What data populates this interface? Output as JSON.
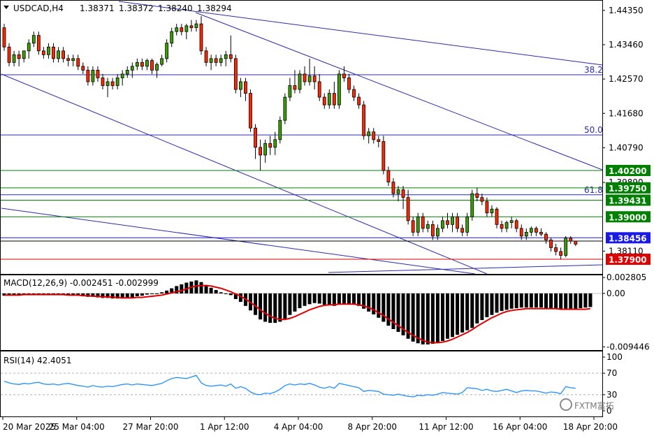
{
  "chart_data": {
    "type": "candlestick",
    "symbol_header": {
      "symbol": "USDCAD,H4",
      "open": "1.38371",
      "high": "1.38372",
      "low": "1.38240",
      "close": "1.38294"
    },
    "price_axis": {
      "ylim": [
        1.3752,
        1.446
      ],
      "ticks": [
        "1.44350",
        "1.43460",
        "1.42570",
        "1.41680",
        "1.40790",
        "1.39890",
        "1.38110"
      ]
    },
    "time_axis": {
      "labels": [
        "20 Mar 2025",
        "25 Mar 04:00",
        "27 Mar 20:00",
        "1 Apr 12:00",
        "4 Apr 04:00",
        "8 Apr 20:00",
        "11 Apr 12:00",
        "16 Apr 04:00",
        "18 Apr 20:00"
      ]
    },
    "fibonacci_levels": [
      {
        "label": "38.2",
        "price": 1.4268
      },
      {
        "label": "50.0",
        "price": 1.4112
      },
      {
        "label": "61.8",
        "price": 1.3957
      }
    ],
    "horizontal_levels": [
      {
        "label": "1.40200",
        "price": 1.402,
        "color": "#008000"
      },
      {
        "label": "1.39750",
        "price": 1.3975,
        "color": "#008000"
      },
      {
        "label": "1.39431",
        "price": 1.39431,
        "color": "#008000"
      },
      {
        "label": "1.39000",
        "price": 1.39,
        "color": "#008000"
      },
      {
        "label": "1.38456",
        "price": 1.38456,
        "color": "#1a1ae6"
      },
      {
        "label": "1.37900",
        "price": 1.379,
        "color": "#e00000"
      }
    ],
    "candles": [
      [
        1.439,
        1.44,
        1.433,
        1.434
      ],
      [
        1.434,
        1.435,
        1.429,
        1.43
      ],
      [
        1.43,
        1.433,
        1.429,
        1.432
      ],
      [
        1.432,
        1.433,
        1.429,
        1.431
      ],
      [
        1.431,
        1.433,
        1.43,
        1.433
      ],
      [
        1.433,
        1.436,
        1.431,
        1.435
      ],
      [
        1.435,
        1.438,
        1.434,
        1.437
      ],
      [
        1.437,
        1.438,
        1.432,
        1.433
      ],
      [
        1.433,
        1.434,
        1.431,
        1.432
      ],
      [
        1.432,
        1.435,
        1.431,
        1.434
      ],
      [
        1.434,
        1.435,
        1.43,
        1.431
      ],
      [
        1.431,
        1.434,
        1.43,
        1.433
      ],
      [
        1.433,
        1.434,
        1.43,
        1.431
      ],
      [
        1.431,
        1.432,
        1.429,
        1.4305
      ],
      [
        1.4305,
        1.432,
        1.429,
        1.431
      ],
      [
        1.431,
        1.432,
        1.428,
        1.429
      ],
      [
        1.429,
        1.43,
        1.427,
        1.428
      ],
      [
        1.428,
        1.429,
        1.424,
        1.425
      ],
      [
        1.425,
        1.429,
        1.424,
        1.428
      ],
      [
        1.428,
        1.429,
        1.425,
        1.426
      ],
      [
        1.426,
        1.427,
        1.423,
        1.424
      ],
      [
        1.424,
        1.426,
        1.421,
        1.425
      ],
      [
        1.425,
        1.426,
        1.423,
        1.424
      ],
      [
        1.424,
        1.427,
        1.423,
        1.426
      ],
      [
        1.426,
        1.428,
        1.424,
        1.427
      ],
      [
        1.427,
        1.429,
        1.426,
        1.428
      ],
      [
        1.428,
        1.43,
        1.426,
        1.429
      ],
      [
        1.429,
        1.431,
        1.428,
        1.43
      ],
      [
        1.43,
        1.431,
        1.428,
        1.429
      ],
      [
        1.429,
        1.431,
        1.428,
        1.4305
      ],
      [
        1.4305,
        1.431,
        1.427,
        1.428
      ],
      [
        1.428,
        1.43,
        1.426,
        1.4295
      ],
      [
        1.4295,
        1.432,
        1.429,
        1.431
      ],
      [
        1.431,
        1.436,
        1.43,
        1.435
      ],
      [
        1.435,
        1.439,
        1.434,
        1.438
      ],
      [
        1.438,
        1.44,
        1.437,
        1.439
      ],
      [
        1.439,
        1.44,
        1.437,
        1.438
      ],
      [
        1.438,
        1.44,
        1.436,
        1.4395
      ],
      [
        1.4395,
        1.441,
        1.438,
        1.439
      ],
      [
        1.439,
        1.441,
        1.438,
        1.44
      ],
      [
        1.44,
        1.442,
        1.432,
        1.433
      ],
      [
        1.433,
        1.434,
        1.429,
        1.43
      ],
      [
        1.43,
        1.432,
        1.428,
        1.431
      ],
      [
        1.431,
        1.432,
        1.429,
        1.43
      ],
      [
        1.43,
        1.432,
        1.429,
        1.431
      ],
      [
        1.431,
        1.433,
        1.429,
        1.432
      ],
      [
        1.432,
        1.437,
        1.43,
        1.431
      ],
      [
        1.431,
        1.432,
        1.422,
        1.423
      ],
      [
        1.423,
        1.426,
        1.421,
        1.425
      ],
      [
        1.425,
        1.426,
        1.42,
        1.422
      ],
      [
        1.422,
        1.423,
        1.412,
        1.413
      ],
      [
        1.413,
        1.414,
        1.405,
        1.408
      ],
      [
        1.408,
        1.41,
        1.402,
        1.406
      ],
      [
        1.406,
        1.41,
        1.404,
        1.409
      ],
      [
        1.409,
        1.411,
        1.406,
        1.408
      ],
      [
        1.408,
        1.412,
        1.406,
        1.41
      ],
      [
        1.41,
        1.416,
        1.409,
        1.415
      ],
      [
        1.415,
        1.422,
        1.414,
        1.421
      ],
      [
        1.421,
        1.426,
        1.42,
        1.424
      ],
      [
        1.424,
        1.428,
        1.422,
        1.423
      ],
      [
        1.423,
        1.428,
        1.422,
        1.427
      ],
      [
        1.427,
        1.429,
        1.424,
        1.425
      ],
      [
        1.425,
        1.431,
        1.424,
        1.4265
      ],
      [
        1.4265,
        1.429,
        1.423,
        1.425
      ],
      [
        1.425,
        1.427,
        1.42,
        1.421
      ],
      [
        1.421,
        1.422,
        1.418,
        1.419
      ],
      [
        1.419,
        1.423,
        1.418,
        1.422
      ],
      [
        1.422,
        1.425,
        1.418,
        1.419
      ],
      [
        1.419,
        1.428,
        1.418,
        1.427
      ],
      [
        1.427,
        1.429,
        1.425,
        1.426
      ],
      [
        1.426,
        1.427,
        1.422,
        1.423
      ],
      [
        1.423,
        1.424,
        1.42,
        1.421
      ],
      [
        1.421,
        1.422,
        1.418,
        1.419
      ],
      [
        1.419,
        1.42,
        1.41,
        1.411
      ],
      [
        1.411,
        1.413,
        1.409,
        1.412
      ],
      [
        1.412,
        1.413,
        1.409,
        1.41
      ],
      [
        1.41,
        1.411,
        1.408,
        1.4095
      ],
      [
        1.4095,
        1.411,
        1.401,
        1.402
      ],
      [
        1.402,
        1.403,
        1.398,
        1.399
      ],
      [
        1.399,
        1.4,
        1.395,
        1.396
      ],
      [
        1.396,
        1.398,
        1.394,
        1.397
      ],
      [
        1.397,
        1.398,
        1.392,
        1.395
      ],
      [
        1.395,
        1.397,
        1.388,
        1.389
      ],
      [
        1.389,
        1.39,
        1.385,
        1.386
      ],
      [
        1.386,
        1.391,
        1.385,
        1.39
      ],
      [
        1.39,
        1.391,
        1.386,
        1.387
      ],
      [
        1.387,
        1.389,
        1.386,
        1.388
      ],
      [
        1.388,
        1.389,
        1.384,
        1.385
      ],
      [
        1.385,
        1.388,
        1.384,
        1.387
      ],
      [
        1.387,
        1.39,
        1.386,
        1.389
      ],
      [
        1.389,
        1.391,
        1.387,
        1.388
      ],
      [
        1.388,
        1.391,
        1.386,
        1.39
      ],
      [
        1.39,
        1.391,
        1.386,
        1.387
      ],
      [
        1.387,
        1.388,
        1.385,
        1.386
      ],
      [
        1.386,
        1.391,
        1.385,
        1.39
      ],
      [
        1.39,
        1.397,
        1.389,
        1.396
      ],
      [
        1.396,
        1.3975,
        1.394,
        1.395
      ],
      [
        1.395,
        1.396,
        1.393,
        1.394
      ],
      [
        1.394,
        1.395,
        1.39,
        1.391
      ],
      [
        1.391,
        1.393,
        1.39,
        1.392
      ],
      [
        1.392,
        1.3925,
        1.387,
        1.388
      ],
      [
        1.388,
        1.389,
        1.386,
        1.387
      ],
      [
        1.387,
        1.389,
        1.386,
        1.3885
      ],
      [
        1.3885,
        1.39,
        1.387,
        1.389
      ],
      [
        1.389,
        1.3895,
        1.386,
        1.387
      ],
      [
        1.387,
        1.388,
        1.384,
        1.385
      ],
      [
        1.385,
        1.387,
        1.384,
        1.386
      ],
      [
        1.386,
        1.3875,
        1.385,
        1.387
      ],
      [
        1.387,
        1.3875,
        1.385,
        1.386
      ],
      [
        1.386,
        1.387,
        1.385,
        1.3855
      ],
      [
        1.3855,
        1.386,
        1.383,
        1.384
      ],
      [
        1.384,
        1.3845,
        1.381,
        1.382
      ],
      [
        1.382,
        1.383,
        1.38,
        1.381
      ],
      [
        1.381,
        1.382,
        1.379,
        1.38
      ],
      [
        1.38,
        1.385,
        1.3795,
        1.3845
      ],
      [
        1.3845,
        1.385,
        1.383,
        1.3837
      ],
      [
        1.3837,
        1.3837,
        1.3824,
        1.3829
      ]
    ],
    "macd": {
      "label": "MACD(12,26,9) -0.002451 -0.002999",
      "ylim": [
        -0.01,
        0.0032
      ],
      "ticks": [
        "0.002805",
        "0.00",
        "-0.009446"
      ],
      "histogram": [
        -0.0004,
        -0.0003,
        -0.0003,
        -0.0002,
        -0.0002,
        -0.0001,
        0.0,
        -0.0001,
        -0.0001,
        -0.0002,
        -0.0002,
        -0.0002,
        -0.0003,
        -0.0003,
        -0.0004,
        -0.0004,
        -0.0005,
        -0.0006,
        -0.0006,
        -0.0007,
        -0.0008,
        -0.0008,
        -0.0009,
        -0.0009,
        -0.0009,
        -0.0008,
        -0.0007,
        -0.0005,
        -0.0004,
        -0.0002,
        -0.0001,
        0.0,
        0.0002,
        0.0005,
        0.0009,
        0.0013,
        0.0016,
        0.0019,
        0.0021,
        0.0023,
        0.002,
        0.0015,
        0.001,
        0.0006,
        0.0002,
        -0.0001,
        -0.0003,
        -0.001,
        -0.0015,
        -0.0022,
        -0.003,
        -0.0038,
        -0.0046,
        -0.005,
        -0.0052,
        -0.0052,
        -0.005,
        -0.0045,
        -0.0038,
        -0.0032,
        -0.0026,
        -0.0022,
        -0.0019,
        -0.0017,
        -0.0018,
        -0.002,
        -0.0021,
        -0.0022,
        -0.002,
        -0.0019,
        -0.0019,
        -0.002,
        -0.0022,
        -0.0027,
        -0.0032,
        -0.0037,
        -0.0043,
        -0.005,
        -0.0057,
        -0.0063,
        -0.0068,
        -0.0074,
        -0.008,
        -0.0085,
        -0.0088,
        -0.009,
        -0.009,
        -0.0089,
        -0.0087,
        -0.0084,
        -0.008,
        -0.0077,
        -0.0073,
        -0.0069,
        -0.0065,
        -0.0061,
        -0.0053,
        -0.0047,
        -0.0042,
        -0.0038,
        -0.0034,
        -0.0031,
        -0.0029,
        -0.0027,
        -0.0026,
        -0.0025,
        -0.0025,
        -0.0025,
        -0.0025,
        -0.0025,
        -0.0026,
        -0.0026,
        -0.0026,
        -0.0027,
        -0.0027,
        -0.0027,
        -0.0027,
        -0.0026,
        -0.0025,
        -0.0024
      ],
      "signal": [
        -0.0003,
        -0.0003,
        -0.0003,
        -0.0003,
        -0.0002,
        -0.0002,
        -0.0002,
        -0.0002,
        -0.0002,
        -0.0002,
        -0.0002,
        -0.0002,
        -0.0002,
        -0.0003,
        -0.0003,
        -0.0003,
        -0.0004,
        -0.0004,
        -0.0005,
        -0.0005,
        -0.0006,
        -0.0006,
        -0.0007,
        -0.0007,
        -0.0008,
        -0.0008,
        -0.0008,
        -0.0007,
        -0.0007,
        -0.0006,
        -0.0005,
        -0.0004,
        -0.0003,
        -0.0001,
        0.0001,
        0.0003,
        0.0005,
        0.0008,
        0.0011,
        0.0013,
        0.0014,
        0.0014,
        0.0013,
        0.0011,
        0.0009,
        0.0006,
        0.0003,
        -0.0001,
        -0.0005,
        -0.001,
        -0.0016,
        -0.0022,
        -0.0029,
        -0.0035,
        -0.004,
        -0.0044,
        -0.0046,
        -0.0046,
        -0.0044,
        -0.0041,
        -0.0037,
        -0.0033,
        -0.0029,
        -0.0026,
        -0.0023,
        -0.0021,
        -0.002,
        -0.002,
        -0.0019,
        -0.0019,
        -0.0019,
        -0.0019,
        -0.002,
        -0.0022,
        -0.0025,
        -0.0029,
        -0.0034,
        -0.0039,
        -0.0045,
        -0.0051,
        -0.0057,
        -0.0063,
        -0.0069,
        -0.0074,
        -0.0079,
        -0.0083,
        -0.0086,
        -0.0087,
        -0.0087,
        -0.0086,
        -0.0084,
        -0.0081,
        -0.0077,
        -0.0073,
        -0.0069,
        -0.0064,
        -0.0058,
        -0.0053,
        -0.0048,
        -0.0043,
        -0.0039,
        -0.0035,
        -0.0032,
        -0.003,
        -0.0029,
        -0.0028,
        -0.0027,
        -0.0027,
        -0.0027,
        -0.0027,
        -0.0027,
        -0.0027,
        -0.0027,
        -0.0028,
        -0.0028,
        -0.0028,
        -0.0028,
        -0.0028,
        -0.0028,
        -0.0027
      ]
    },
    "rsi": {
      "label": "RSI(14) 42.4051",
      "ylim": [
        0,
        100
      ],
      "levels": [
        30,
        70
      ],
      "ticks": [
        "100",
        "70",
        "30",
        "0"
      ],
      "values": [
        55,
        52,
        50,
        49,
        51,
        50,
        52,
        53,
        50,
        49,
        50,
        48,
        50,
        51,
        49,
        47,
        46,
        44,
        47,
        45,
        44,
        46,
        45,
        47,
        49,
        50,
        48,
        50,
        49,
        48,
        47,
        49,
        51,
        56,
        60,
        62,
        61,
        60,
        63,
        66,
        52,
        47,
        46,
        47,
        48,
        46,
        50,
        42,
        45,
        42,
        35,
        31,
        30,
        33,
        32,
        35,
        40,
        47,
        50,
        48,
        50,
        49,
        51,
        48,
        44,
        42,
        45,
        42,
        51,
        49,
        47,
        45,
        43,
        36,
        38,
        37,
        36,
        31,
        30,
        29,
        31,
        29,
        27,
        26,
        29,
        28,
        30,
        29,
        31,
        34,
        33,
        32,
        31,
        34,
        43,
        42,
        41,
        38,
        40,
        37,
        36,
        38,
        40,
        37,
        34,
        37,
        38,
        37,
        37,
        35,
        33,
        35,
        34,
        32,
        45,
        43,
        42
      ]
    }
  },
  "watermark": {
    "text": "FXTM富拓"
  }
}
